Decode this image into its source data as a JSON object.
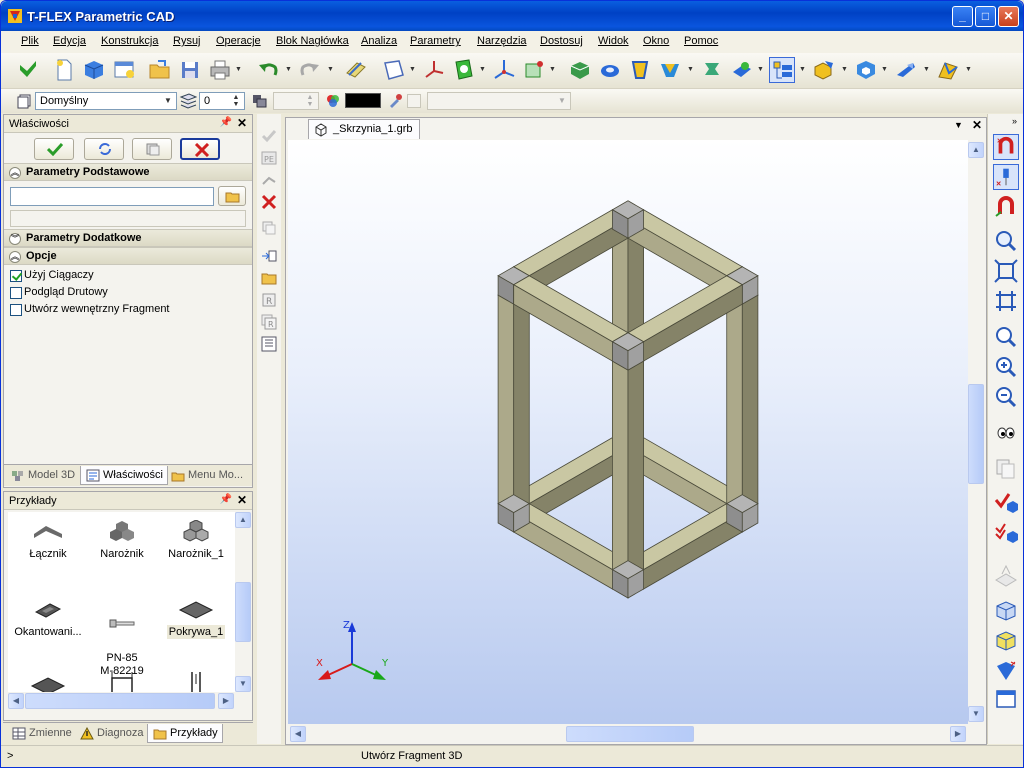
{
  "window": {
    "title": "T-FLEX Parametric CAD"
  },
  "menu": [
    "Plik",
    "Edycja",
    "Konstrukcja",
    "Rysuj",
    "Operacje",
    "Blok Nagłówka",
    "Analiza",
    "Parametry",
    "Narzędzia",
    "Dostosuj",
    "Widok",
    "Okno",
    "Pomoc"
  ],
  "toolbar2": {
    "layer_value": "Domyślny",
    "level_value": "0"
  },
  "properties": {
    "title": "Właściwości",
    "section_basic": "Parametry Podstawowe",
    "section_extra": "Parametry Dodatkowe",
    "section_options": "Opcje",
    "options": [
      {
        "label": "Użyj Ciągaczy",
        "checked": true
      },
      {
        "label": "Podgląd Drutowy",
        "checked": false
      },
      {
        "label": "Utwórz wewnętrzny Fragment",
        "checked": false
      }
    ],
    "tabs": [
      "Model 3D",
      "Właściwości",
      "Menu Mo..."
    ]
  },
  "examples": {
    "title": "Przykłady",
    "items": [
      "Łącznik",
      "Narożnik",
      "Narożnik_1",
      "Okantowani...",
      "PN-85\nM-82219",
      "Pokrywa_1",
      "",
      "",
      ""
    ],
    "tabs": [
      "Zmienne",
      "Diagnoza",
      "Przykłady"
    ]
  },
  "document": {
    "tab_label": "_Skrzynia_1.grb"
  },
  "axes": {
    "x": "X",
    "y": "Y",
    "z": "Z"
  },
  "status": {
    "left": ">",
    "message": "Utwórz Fragment 3D"
  },
  "colors": {
    "frame_light": "#c9c7a3",
    "frame_mid": "#aca98a",
    "frame_dark": "#858368",
    "corner_top": "#b4b4b4",
    "corner_side": "#8e8e8e"
  }
}
